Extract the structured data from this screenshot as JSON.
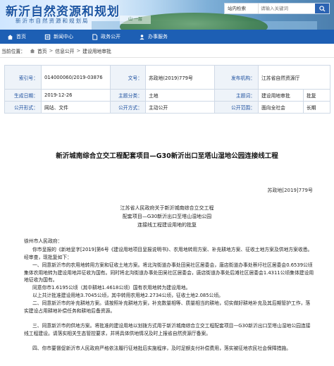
{
  "header": {
    "site_title": "新沂自然资源和规划",
    "site_subtitle": "新沂市自然资源和规划局",
    "banner_stamp": "山·一层",
    "search_scope": "站内检索",
    "search_placeholder": "请输入关键词"
  },
  "nav": {
    "items": [
      {
        "label": "首页"
      },
      {
        "label": "新闻中心"
      },
      {
        "label": "政务公开"
      },
      {
        "label": "办事服务"
      }
    ]
  },
  "breadcrumb": {
    "prefix": "当前位置：",
    "items": [
      "首页",
      "信息公开",
      "建设用地审批"
    ]
  },
  "info": {
    "index_label": "索引号：",
    "index_value": "014000060/2019-03876",
    "docno_label": "文号：",
    "docno_value": "苏政地(2019)779号",
    "issuer_label": "发布机构：",
    "issuer_value": "江苏省自然资源厅",
    "date_label": "生成日期：",
    "date_value": "2019-12-26",
    "subject_label": "主题分类：",
    "subject_value": "土地",
    "topic_label": "主题词：",
    "topic_value": "建设用地审批",
    "type_label": "公开方式：",
    "type_value": "批复",
    "form_label": "公开形式：",
    "form_value": "网站、文件",
    "mode_label": "公开方式：",
    "mode_value": "主动公开",
    "scope_label": "公开范围：",
    "scope_value": "面向全社会",
    "term_label": "公开时限：",
    "term_value": "长期"
  },
  "document": {
    "title": "新沂城南综合立交工程配套项目—G30新沂出口至塔山湿地公园连接线工程",
    "doc_number": "苏政地[2019]779号",
    "heading_lines": [
      "江苏省人民政府关于新沂城南综合立交工程",
      "配套项目—G30新沂出口至塔山湿地公园",
      "连接线工程建设用地的批复"
    ],
    "salutation": "徐州市人民政府：",
    "paragraphs": [
      "你市呈报的《新地呈字[2019]第6号《建设用地项目呈报说明书》、农用地转用方案、补充耕地方案、征收土地方案及供地方案收悉。经审查，现批复如下：",
      "一、同意新沂市的农用地转用方案和征收土地方案。将北沟街道办事处田吴社区居委会，唐店街道办事处蔡圩社区居委会0.6539公顷集体农用地转为建设用地并征收为国有。同时将北沟街道办事处田吴社区居委会，唐店街道办事处后滩社区居委会1.4311公顷集体建设用地征收为国有。",
      "同意你市1.6195公顷（其中耕地1.4618公顷）国有农用地转为建设用地。",
      "以上共计批准建设用地3.7045公顷，其中转用农用地2.2734公顷，征收土地2.085公顷。",
      "二、同意新沂市的补充耕地方案。请按照补充耕地方案，补充数量相等、质量相当的耕地，切实做好耕地补充及其后期管护工作，落实建设占用耕地补偿任务和耕地后备资源。",
      "三、同意新沂市的供地方案。将批准的建设用地以划拨方式用于新沂城南综合立交工程配套项目—G30新沂出口至塔山湿地公园连接线工程建设。请落实相关生态管控要求，并将具体供地情况及时上报省自然资源厅备案。",
      "四、你市要督促新沂市人民政府严格依法履行征地批后实施程序，及时足额支付补偿费用，落实被征地农民社会保障措施。"
    ]
  },
  "colors": {
    "nav_bg": "#1d5fb4",
    "title_blue": "#1b55a3",
    "label_blue": "#1c4f9e"
  }
}
